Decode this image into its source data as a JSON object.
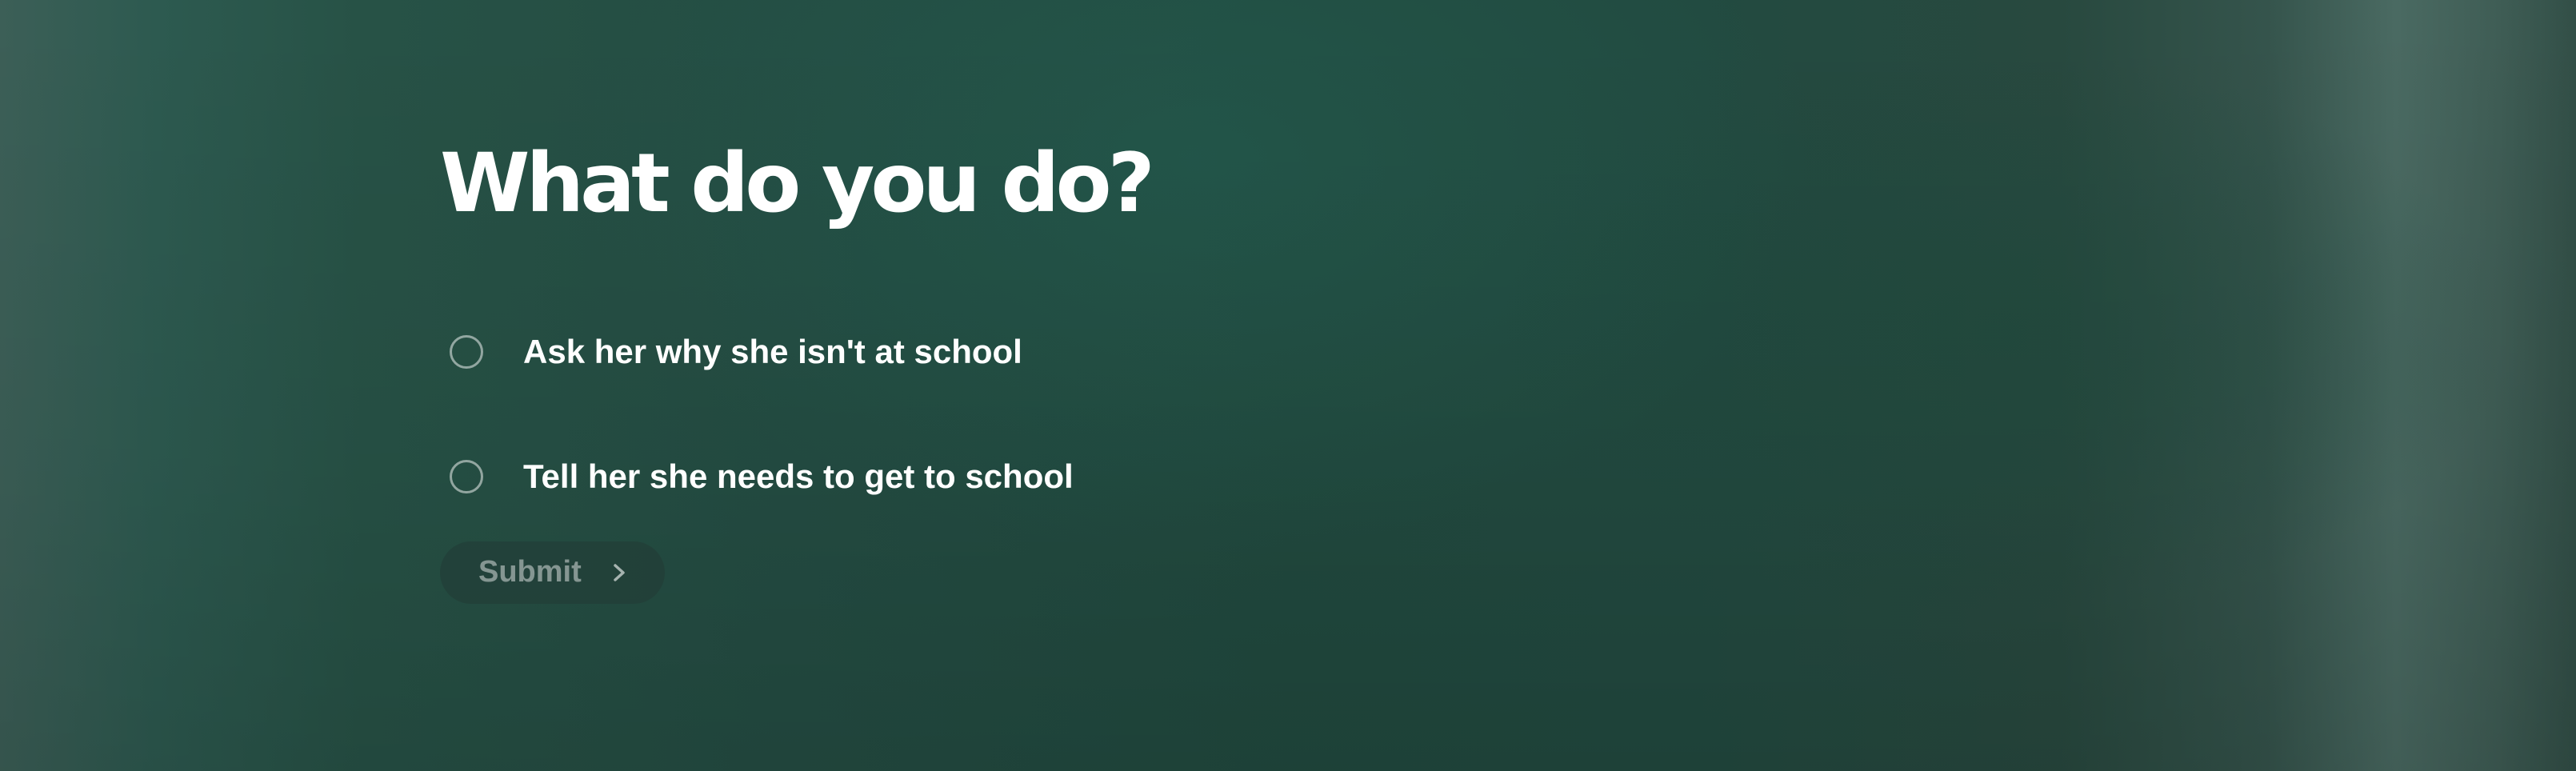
{
  "question": {
    "title": "What do you do?"
  },
  "options": [
    {
      "label": "Ask her why she isn't at school",
      "selected": false
    },
    {
      "label": "Tell her she needs to get to school",
      "selected": false
    }
  ],
  "submit": {
    "label": "Submit",
    "icon": "chevron-right-icon",
    "enabled": false
  },
  "colors": {
    "background": "#244d43",
    "text": "#ffffff"
  }
}
